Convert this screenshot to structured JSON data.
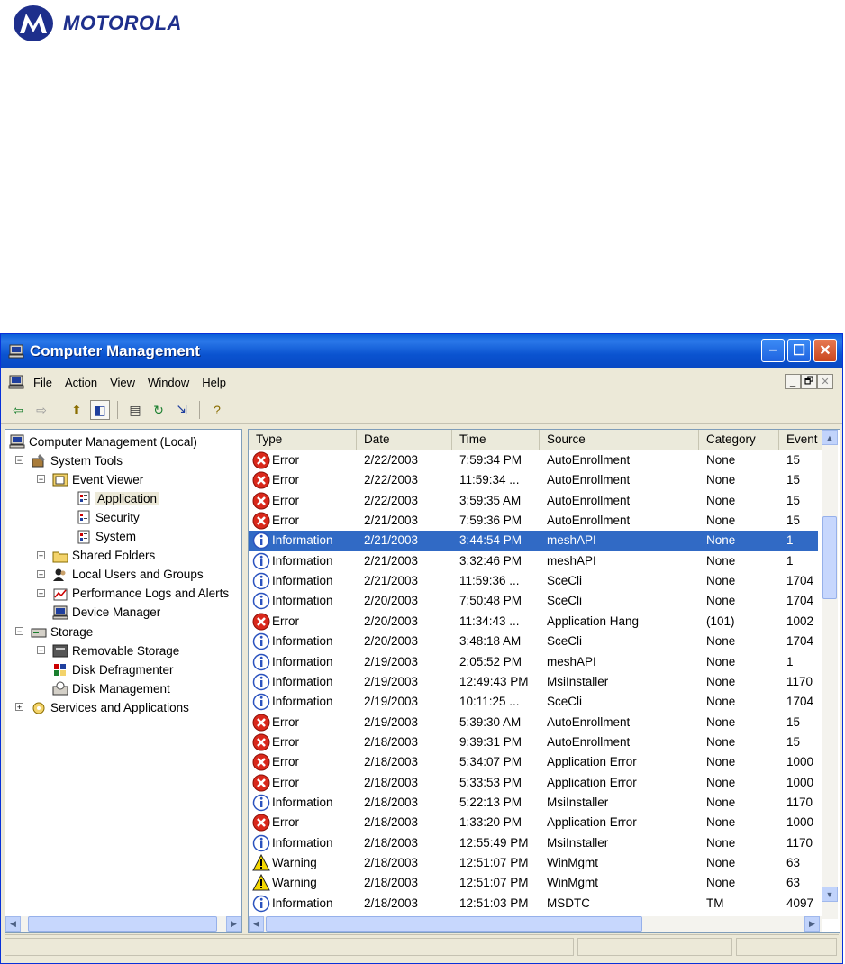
{
  "logo": {
    "text": "MOTOROLA"
  },
  "window": {
    "title": "Computer Management"
  },
  "menu": [
    "File",
    "Action",
    "View",
    "Window",
    "Help"
  ],
  "mdi_buttons": [
    "_",
    "🗗",
    "✕"
  ],
  "tree": [
    {
      "label": "Computer Management (Local)",
      "level": 0,
      "icon": "computer-icon",
      "expander": ""
    },
    {
      "label": "System Tools",
      "level": 1,
      "icon": "tools-icon",
      "expander": "−"
    },
    {
      "label": "Event Viewer",
      "level": 2,
      "icon": "event-viewer-icon",
      "expander": "−"
    },
    {
      "label": "Application",
      "level": 3,
      "icon": "log-icon",
      "expander": "",
      "selected": true
    },
    {
      "label": "Security",
      "level": 3,
      "icon": "log-icon",
      "expander": ""
    },
    {
      "label": "System",
      "level": 3,
      "icon": "log-icon",
      "expander": ""
    },
    {
      "label": "Shared Folders",
      "level": 2,
      "icon": "folder-icon",
      "expander": "+"
    },
    {
      "label": "Local Users and Groups",
      "level": 2,
      "icon": "users-icon",
      "expander": "+"
    },
    {
      "label": "Performance Logs and Alerts",
      "level": 2,
      "icon": "performance-icon",
      "expander": "+"
    },
    {
      "label": "Device Manager",
      "level": 2,
      "icon": "device-manager-icon",
      "expander": ""
    },
    {
      "label": "Storage",
      "level": 1,
      "icon": "storage-icon",
      "expander": "−"
    },
    {
      "label": "Removable Storage",
      "level": 2,
      "icon": "removable-storage-icon",
      "expander": "+"
    },
    {
      "label": "Disk Defragmenter",
      "level": 2,
      "icon": "defrag-icon",
      "expander": ""
    },
    {
      "label": "Disk Management",
      "level": 2,
      "icon": "disk-management-icon",
      "expander": ""
    },
    {
      "label": "Services and Applications",
      "level": 1,
      "icon": "services-icon",
      "expander": "+"
    }
  ],
  "columns": [
    "Type",
    "Date",
    "Time",
    "Source",
    "Category",
    "Event"
  ],
  "events": [
    {
      "type": "Error",
      "date": "2/22/2003",
      "time": "7:59:34 PM",
      "source": "AutoEnrollment",
      "category": "None",
      "event": "15"
    },
    {
      "type": "Error",
      "date": "2/22/2003",
      "time": "11:59:34 ...",
      "source": "AutoEnrollment",
      "category": "None",
      "event": "15"
    },
    {
      "type": "Error",
      "date": "2/22/2003",
      "time": "3:59:35 AM",
      "source": "AutoEnrollment",
      "category": "None",
      "event": "15"
    },
    {
      "type": "Error",
      "date": "2/21/2003",
      "time": "7:59:36 PM",
      "source": "AutoEnrollment",
      "category": "None",
      "event": "15"
    },
    {
      "type": "Information",
      "date": "2/21/2003",
      "time": "3:44:54 PM",
      "source": "meshAPI",
      "category": "None",
      "event": "1",
      "selected": true
    },
    {
      "type": "Information",
      "date": "2/21/2003",
      "time": "3:32:46 PM",
      "source": "meshAPI",
      "category": "None",
      "event": "1"
    },
    {
      "type": "Information",
      "date": "2/21/2003",
      "time": "11:59:36 ...",
      "source": "SceCli",
      "category": "None",
      "event": "1704"
    },
    {
      "type": "Information",
      "date": "2/20/2003",
      "time": "7:50:48 PM",
      "source": "SceCli",
      "category": "None",
      "event": "1704"
    },
    {
      "type": "Error",
      "date": "2/20/2003",
      "time": "11:34:43 ...",
      "source": "Application Hang",
      "category": "(101)",
      "event": "1002"
    },
    {
      "type": "Information",
      "date": "2/20/2003",
      "time": "3:48:18 AM",
      "source": "SceCli",
      "category": "None",
      "event": "1704"
    },
    {
      "type": "Information",
      "date": "2/19/2003",
      "time": "2:05:52 PM",
      "source": "meshAPI",
      "category": "None",
      "event": "1"
    },
    {
      "type": "Information",
      "date": "2/19/2003",
      "time": "12:49:43 PM",
      "source": "MsiInstaller",
      "category": "None",
      "event": "1170"
    },
    {
      "type": "Information",
      "date": "2/19/2003",
      "time": "10:11:25 ...",
      "source": "SceCli",
      "category": "None",
      "event": "1704"
    },
    {
      "type": "Error",
      "date": "2/19/2003",
      "time": "5:39:30 AM",
      "source": "AutoEnrollment",
      "category": "None",
      "event": "15"
    },
    {
      "type": "Error",
      "date": "2/18/2003",
      "time": "9:39:31 PM",
      "source": "AutoEnrollment",
      "category": "None",
      "event": "15"
    },
    {
      "type": "Error",
      "date": "2/18/2003",
      "time": "5:34:07 PM",
      "source": "Application Error",
      "category": "None",
      "event": "1000"
    },
    {
      "type": "Error",
      "date": "2/18/2003",
      "time": "5:33:53 PM",
      "source": "Application Error",
      "category": "None",
      "event": "1000"
    },
    {
      "type": "Information",
      "date": "2/18/2003",
      "time": "5:22:13 PM",
      "source": "MsiInstaller",
      "category": "None",
      "event": "1170"
    },
    {
      "type": "Error",
      "date": "2/18/2003",
      "time": "1:33:20 PM",
      "source": "Application Error",
      "category": "None",
      "event": "1000"
    },
    {
      "type": "Information",
      "date": "2/18/2003",
      "time": "12:55:49 PM",
      "source": "MsiInstaller",
      "category": "None",
      "event": "1170"
    },
    {
      "type": "Warning",
      "date": "2/18/2003",
      "time": "12:51:07 PM",
      "source": "WinMgmt",
      "category": "None",
      "event": "63"
    },
    {
      "type": "Warning",
      "date": "2/18/2003",
      "time": "12:51:07 PM",
      "source": "WinMgmt",
      "category": "None",
      "event": "63"
    },
    {
      "type": "Information",
      "date": "2/18/2003",
      "time": "12:51:03 PM",
      "source": "MSDTC",
      "category": "TM",
      "event": "4097"
    }
  ],
  "colors": {
    "accent": "#316ac5",
    "titlebar": "#0a53d0",
    "error": "#d9281b",
    "info": "#2a52be",
    "warning": "#f5d800"
  }
}
